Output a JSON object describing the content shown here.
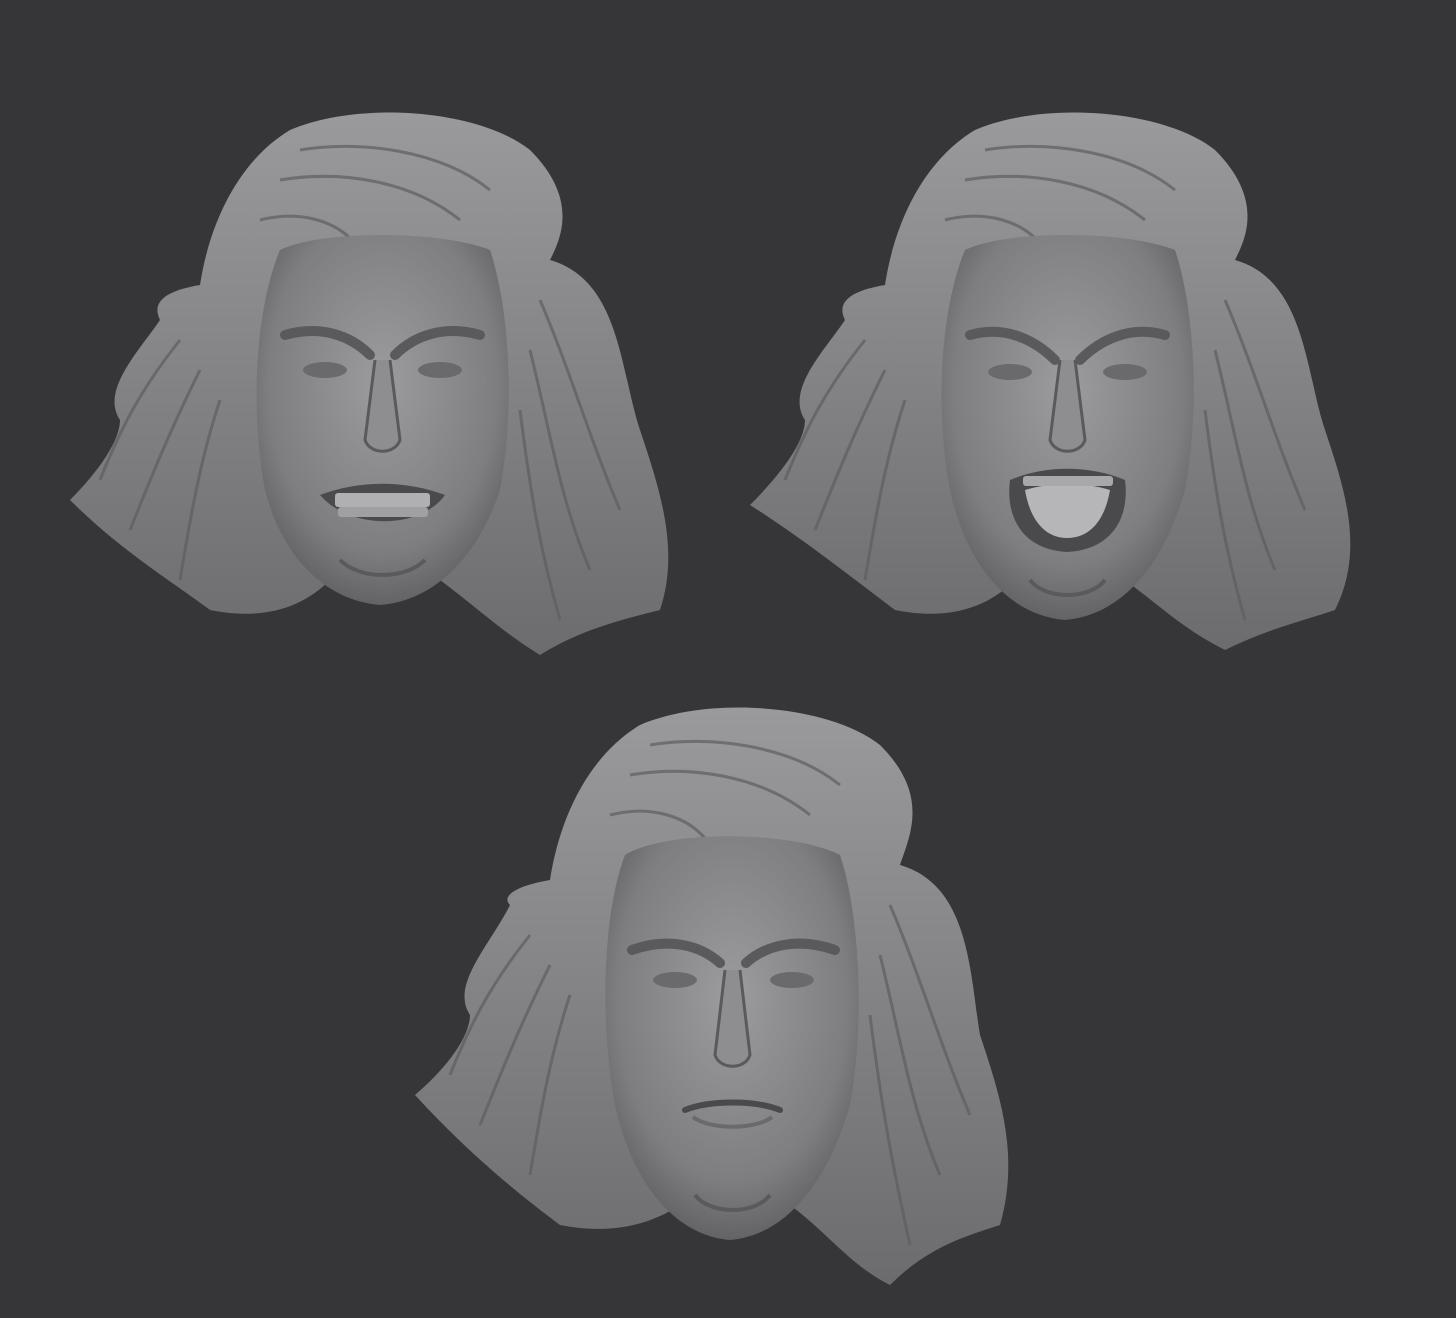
{
  "scene": {
    "background_color": "#363638",
    "material_color": "#8a8a8c",
    "highlight_color": "#b4b4b6",
    "shadow_color": "#4a4a4c"
  },
  "sculpts": [
    {
      "expression": "snarl",
      "mouth": "teeth-bared"
    },
    {
      "expression": "roar",
      "mouth": "open"
    },
    {
      "expression": "neutral-frown",
      "mouth": "closed"
    }
  ]
}
